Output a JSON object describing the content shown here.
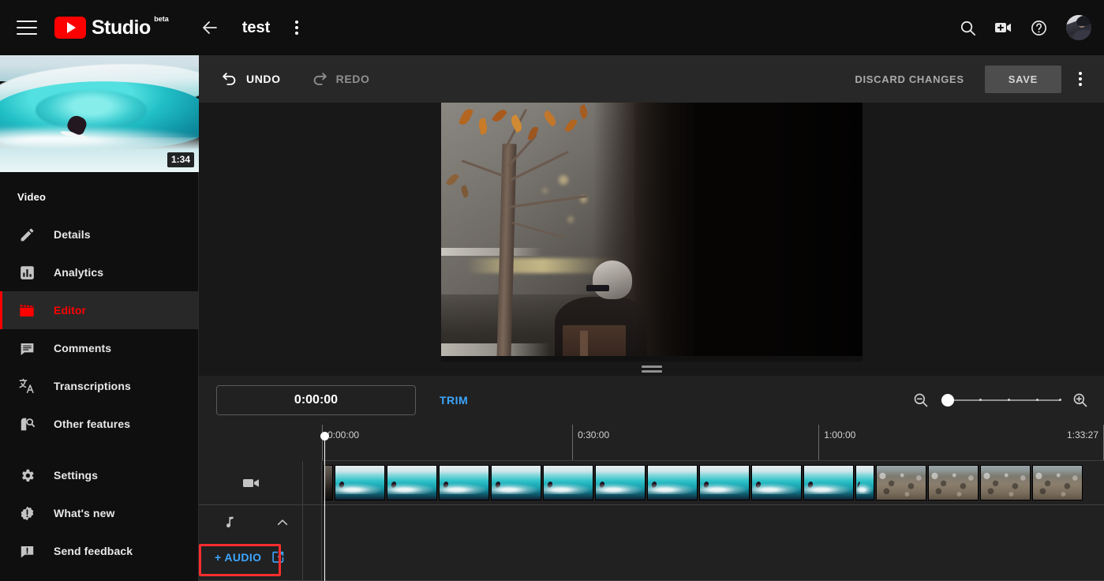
{
  "topbar": {
    "menu_icon": "hamburger-menu-icon",
    "brand": "Studio",
    "brand_badge": "beta",
    "back_icon": "back-arrow-icon",
    "video_title": "test",
    "title_menu_icon": "kebab-menu-icon",
    "search_icon": "search-icon",
    "create_icon": "create-video-icon",
    "help_icon": "help-icon",
    "avatar": "account-avatar"
  },
  "sidebar": {
    "thumbnail_duration": "1:34",
    "section_label": "Video",
    "items": [
      {
        "label": "Details",
        "icon": "pencil-icon",
        "active": false
      },
      {
        "label": "Analytics",
        "icon": "analytics-icon",
        "active": false
      },
      {
        "label": "Editor",
        "icon": "clapperboard-icon",
        "active": true
      },
      {
        "label": "Comments",
        "icon": "comment-icon",
        "active": false
      },
      {
        "label": "Transcriptions",
        "icon": "translate-icon",
        "active": false
      },
      {
        "label": "Other features",
        "icon": "other-features-icon",
        "active": false
      }
    ],
    "bottom_items": [
      {
        "label": "Settings",
        "icon": "gear-icon"
      },
      {
        "label": "What's new",
        "icon": "whats-new-icon"
      },
      {
        "label": "Send feedback",
        "icon": "send-feedback-icon"
      }
    ],
    "active_accent": "#ff0000"
  },
  "editor_toolbar": {
    "undo_label": "UNDO",
    "undo_icon": "undo-arrow-icon",
    "redo_label": "REDO",
    "redo_icon": "redo-arrow-icon",
    "redo_disabled": true,
    "discard_label": "DISCARD CHANGES",
    "save_label": "SAVE",
    "overflow_icon": "kebab-menu-icon"
  },
  "preview": {
    "scene_description": "dark autumn scene with tree and seated person"
  },
  "timeline_controls": {
    "timecode_value": "0:00:00",
    "trim_label": "TRIM",
    "zoom_out_icon": "zoom-out-icon",
    "zoom_in_icon": "zoom-in-icon",
    "zoom_level_percent": 0,
    "zoom_ticks": [
      0,
      25,
      50,
      75,
      100
    ]
  },
  "timeline": {
    "ruler_marks": [
      {
        "label": "0:00:00",
        "position_percent": 0
      },
      {
        "label": "0:30:00",
        "position_percent": 32
      },
      {
        "label": "1:00:00",
        "position_percent": 63.5
      },
      {
        "label": "1:33:27",
        "position_percent": 100
      }
    ],
    "playhead_position_percent": 0,
    "playhead_time": "0:00:00",
    "video_track": {
      "icon": "video-camera-icon",
      "frames": [
        "partial-wave",
        "wave",
        "wave",
        "wave",
        "wave",
        "wave",
        "wave",
        "wave",
        "wave",
        "wave",
        "wave",
        "narrow-wave",
        "crowd",
        "crowd",
        "crowd",
        "crowd"
      ]
    },
    "audio_track": {
      "icon": "music-note-icon",
      "collapse_icon": "chevron-up-icon",
      "add_audio_label": "+ AUDIO",
      "add_audio_external_icon": "external-link-icon",
      "add_audio_accent": "#3ea6ff",
      "highlight_color": "#ff2d2d"
    }
  }
}
